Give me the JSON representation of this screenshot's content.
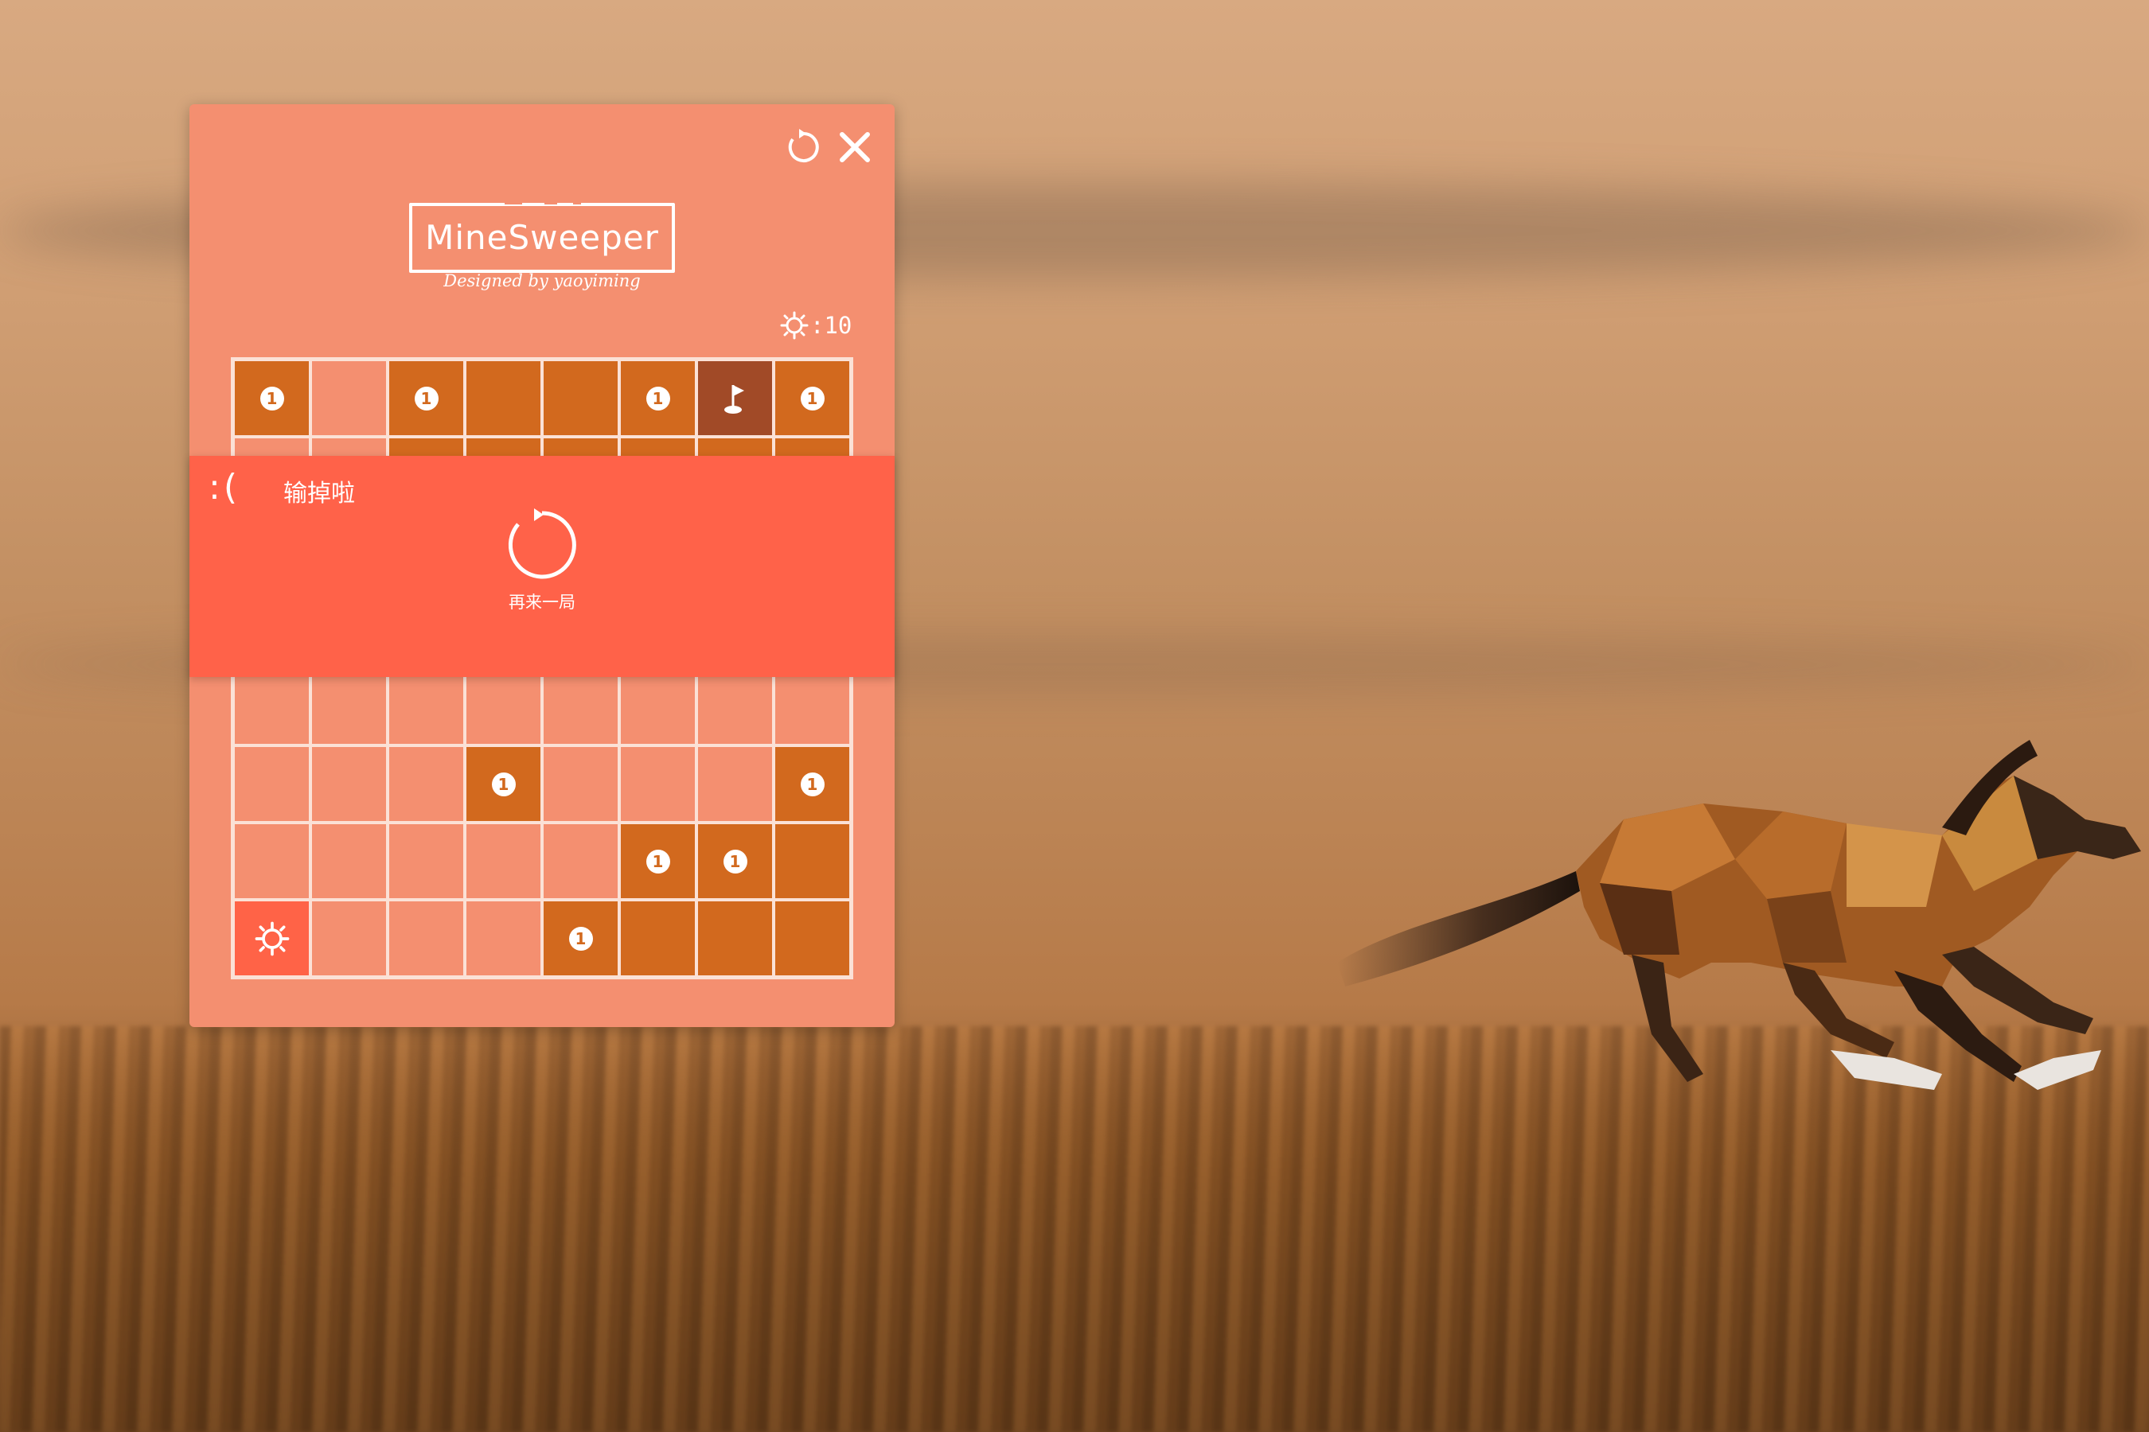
{
  "app": {
    "logo_title": "MineSweeper",
    "logo_subtitle": "Designed by yaoyiming"
  },
  "toolbar": {
    "refresh_icon": "refresh-icon",
    "close_icon": "close-icon"
  },
  "status": {
    "mine_icon": "mine-icon",
    "mine_count": ":10"
  },
  "overlay": {
    "face": ":(",
    "message": "输掉啦",
    "retry_label": "再来一局",
    "retry_icon": "restart-icon"
  },
  "colors": {
    "window_bg": "#f48f70",
    "opened_cell": "#d2691e",
    "flag_cell": "#a14a27",
    "exploded_cell": "#ff6347",
    "overlay_bg": "#ff6249",
    "grid_line": "#fbe1d6"
  },
  "board": {
    "rows": 8,
    "cols": 8,
    "cells": [
      [
        "o1",
        "c",
        "o1",
        "o",
        "o",
        "o1",
        "f",
        "o1"
      ],
      [
        "c",
        "c",
        "o",
        "o",
        "o",
        "o",
        "o",
        "o"
      ],
      [
        "c",
        "c",
        "c",
        "c",
        "c",
        "c",
        "c",
        "c"
      ],
      [
        "c",
        "c",
        "c",
        "c",
        "c",
        "c",
        "c",
        "c"
      ],
      [
        "c",
        "c",
        "c",
        "c",
        "c",
        "c",
        "c",
        "c"
      ],
      [
        "c",
        "c",
        "c",
        "o1",
        "c",
        "c",
        "c",
        "o1"
      ],
      [
        "c",
        "c",
        "c",
        "c",
        "c",
        "o1",
        "o1",
        "o"
      ],
      [
        "m",
        "c",
        "c",
        "c",
        "o1",
        "o",
        "o",
        "o"
      ]
    ]
  }
}
